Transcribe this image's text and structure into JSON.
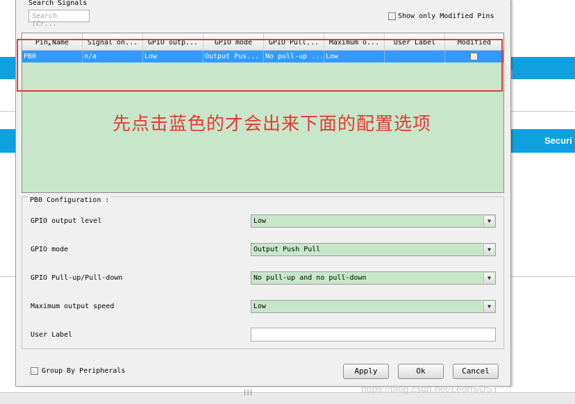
{
  "background": {
    "security_label": "Securi"
  },
  "dialog": {
    "search_label": "Search Signals",
    "search_placeholder": "Search (Cr...",
    "show_modified_label": "Show only Modified Pins",
    "columns": [
      "Pin Name",
      "Signal on...",
      "GPIO outp...",
      "GPIO mode",
      "GPIO Pull...",
      "Maximum o...",
      "User Label",
      "Modified"
    ],
    "rows": [
      {
        "pin_name": "PB0",
        "signal": "n/a",
        "gpio_output": "Low",
        "gpio_mode": "Output Pus...",
        "gpio_pull": "No pull-up ...",
        "max_output": "Low",
        "user_label": "",
        "modified": false
      }
    ],
    "annotation": "先点击蓝色的才会出来下面的配置选项",
    "annotation_color": "#e53935",
    "selection_color": "#3399ff",
    "config": {
      "title": "PB0 Configuration :",
      "fields": [
        {
          "label": "GPIO output level",
          "value": "Low"
        },
        {
          "label": "GPIO mode",
          "value": "Output Push Pull"
        },
        {
          "label": "GPIO Pull-up/Pull-down",
          "value": "No pull-up and no pull-down"
        },
        {
          "label": "Maximum output speed",
          "value": "Low"
        }
      ],
      "user_label_label": "User Label",
      "user_label_value": ""
    },
    "group_by_label": "Group By Peripherals",
    "buttons": {
      "apply": "Apply",
      "ok": "Ok",
      "cancel": "Cancel"
    },
    "grip": "|||"
  },
  "watermark": "https://blog.csdn.net/LeonSUST"
}
